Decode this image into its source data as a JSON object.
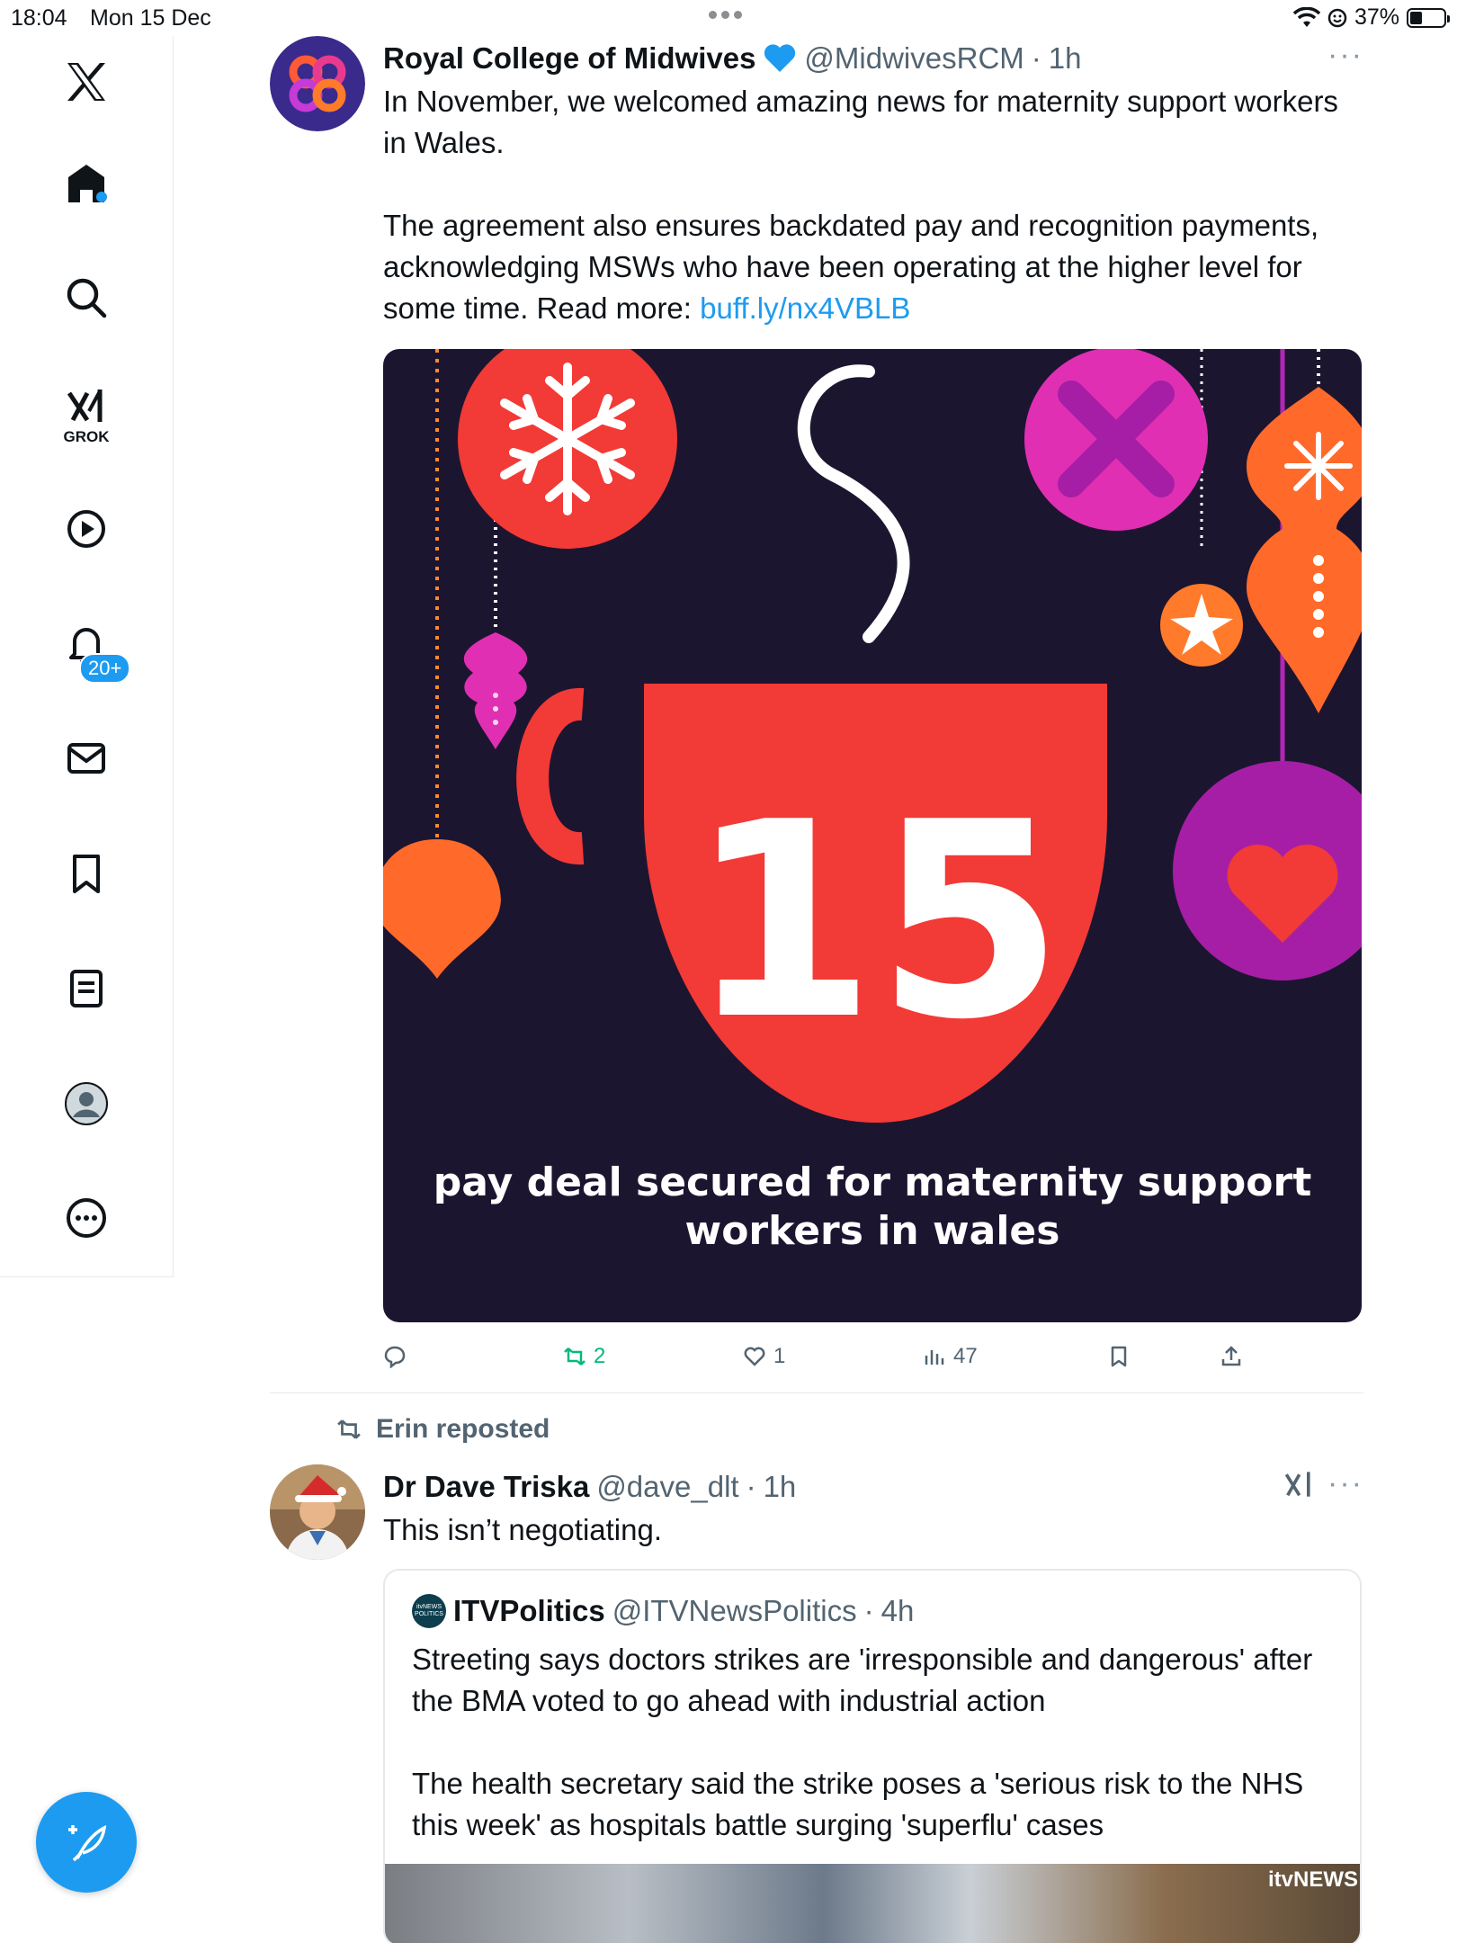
{
  "status": {
    "time": "18:04",
    "date": "Mon 15 Dec",
    "battery": "37%",
    "battery_level": 0.37
  },
  "sidebar": {
    "grok_label": "GROK",
    "notifications_badge": "20+"
  },
  "post1": {
    "author": "Royal College of Midwives",
    "handle": "@MidwivesRCM",
    "dot": "·",
    "time": "1h",
    "more": "···",
    "text_main": "In November, we welcomed amazing news for maternity support workers in Wales.\n\nThe agreement also ensures backdated pay and recognition payments, acknowledging MSWs who have been operating at the higher level for some time. Read more: ",
    "link": "buff.ly/nx4VBLB",
    "image": {
      "number": "15",
      "caption_line1": "pay deal secured for maternity support",
      "caption_line2": "workers in wales"
    },
    "actions": {
      "reposts": "2",
      "likes": "1",
      "views": "47"
    }
  },
  "post2": {
    "repost_by": "Erin reposted",
    "author": "Dr Dave Triska",
    "handle": "@dave_dlt",
    "dot": "·",
    "time": "1h",
    "more": "···",
    "text": "This isn’t negotiating.",
    "quote": {
      "avatar_text": "itvNEWS POLITICS",
      "author": "ITVPolitics",
      "handle": "@ITVNewsPolitics",
      "dot": "·",
      "time": "4h",
      "text": "Streeting says doctors strikes are 'irresponsible and dangerous' after the BMA voted to go ahead with industrial action\n\nThe health secretary said the strike poses a 'serious risk to the NHS this week' as hospitals battle surging 'superflu' cases",
      "media_logo": "itvNEWS"
    }
  },
  "colors": {
    "accent": "#1d9bf0",
    "repost_green": "#00ba7c",
    "image_bg": "#1c1530",
    "mug_red": "#f23a36"
  }
}
